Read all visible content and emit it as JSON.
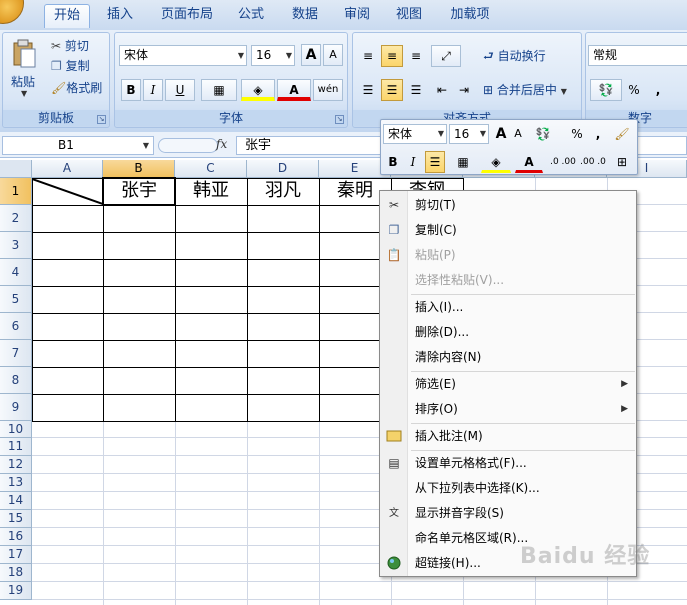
{
  "tabs": [
    "开始",
    "插入",
    "页面布局",
    "公式",
    "数据",
    "审阅",
    "视图",
    "加载项"
  ],
  "ribbon": {
    "clipboard": {
      "paste": "粘贴",
      "cut": "剪切",
      "copy": "复制",
      "format_painter": "格式刷",
      "label": "剪贴板"
    },
    "font": {
      "family": "宋体",
      "size": "16",
      "label": "字体",
      "bold": "B",
      "italic": "I",
      "underline": "U",
      "grow": "A",
      "shrink": "A",
      "phonetic": "wén"
    },
    "alignment": {
      "wrap": "自动换行",
      "merge": "合并后居中",
      "label": "对齐方式"
    },
    "number": {
      "format": "常规",
      "percent": "%",
      "comma": ",",
      "label": "数字"
    }
  },
  "formula_bar": {
    "name_box": "B1",
    "fx": "fx",
    "content": "张宇"
  },
  "columns": [
    "A",
    "B",
    "C",
    "D",
    "E",
    "",
    "",
    "",
    "I"
  ],
  "rows": [
    "1",
    "2",
    "3",
    "4",
    "5",
    "6",
    "7",
    "8",
    "9",
    "10",
    "11",
    "12",
    "13",
    "14",
    "15",
    "16",
    "17",
    "18",
    "19"
  ],
  "table_headers": [
    "张宇",
    "韩亚",
    "羽凡",
    "秦明",
    "李钢"
  ],
  "mini_toolbar": {
    "font": "宋体",
    "size": "16",
    "percent": "%",
    "comma": ",",
    "bold": "B",
    "italic": "I",
    "dec_inc": ".0 .00",
    "dec_dec": ".00 .0"
  },
  "context_menu": [
    {
      "label": "剪切(T)",
      "icon": "scissors-icon",
      "disabled": false
    },
    {
      "label": "复制(C)",
      "icon": "copy-icon",
      "disabled": false
    },
    {
      "label": "粘贴(P)",
      "icon": "paste-icon",
      "disabled": true
    },
    {
      "label": "选择性粘贴(V)...",
      "icon": "",
      "disabled": true
    },
    {
      "label": "插入(I)...",
      "icon": "",
      "disabled": false
    },
    {
      "label": "删除(D)...",
      "icon": "",
      "disabled": false
    },
    {
      "label": "清除内容(N)",
      "icon": "",
      "disabled": false
    },
    {
      "label": "筛选(E)",
      "icon": "",
      "disabled": false,
      "submenu": true
    },
    {
      "label": "排序(O)",
      "icon": "",
      "disabled": false,
      "submenu": true
    },
    {
      "label": "插入批注(M)",
      "icon": "comment-icon",
      "disabled": false
    },
    {
      "label": "设置单元格格式(F)...",
      "icon": "format-cells-icon",
      "disabled": false
    },
    {
      "label": "从下拉列表中选择(K)...",
      "icon": "",
      "disabled": false
    },
    {
      "label": "显示拼音字段(S)",
      "icon": "phonetic-icon",
      "disabled": false
    },
    {
      "label": "命名单元格区域(R)...",
      "icon": "",
      "disabled": false
    },
    {
      "label": "超链接(H)...",
      "icon": "hyperlink-icon",
      "disabled": false
    }
  ],
  "watermark": "Baidu 经验"
}
